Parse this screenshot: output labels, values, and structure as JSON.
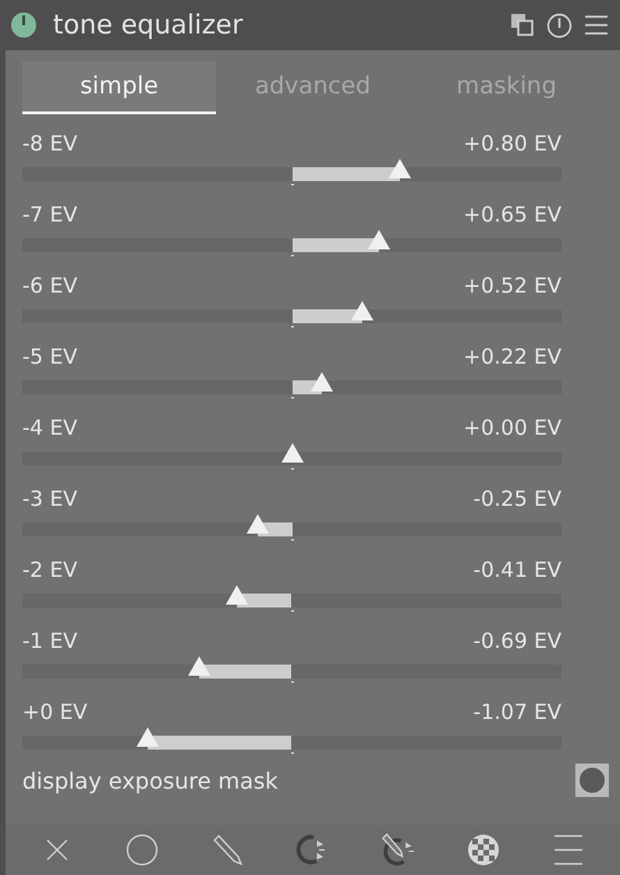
{
  "module": {
    "title": "tone equalizer",
    "enabled": true
  },
  "tabs": [
    {
      "label": "simple",
      "selected": true
    },
    {
      "label": "advanced",
      "selected": false
    },
    {
      "label": "masking",
      "selected": false
    }
  ],
  "bands": [
    {
      "label": "-8 EV",
      "reading": "+0.80 EV",
      "level": 0.7
    },
    {
      "label": "-7 EV",
      "reading": "+0.65 EV",
      "level": 0.6625
    },
    {
      "label": "-6 EV",
      "reading": "+0.52 EV",
      "level": 0.63
    },
    {
      "label": "-5 EV",
      "reading": "+0.22 EV",
      "level": 0.555
    },
    {
      "label": "-4 EV",
      "reading": "+0.00 EV",
      "level": 0.5
    },
    {
      "label": "-3 EV",
      "reading": "-0.25 EV",
      "level": 0.4375
    },
    {
      "label": "-2 EV",
      "reading": "-0.41 EV",
      "level": 0.3975
    },
    {
      "label": "-1 EV",
      "reading": "-0.69 EV",
      "level": 0.3275
    },
    {
      "label": "+0 EV",
      "reading": "-1.07 EV",
      "level": 0.2325
    }
  ],
  "mask_toggle": {
    "label": "display exposure mask"
  }
}
